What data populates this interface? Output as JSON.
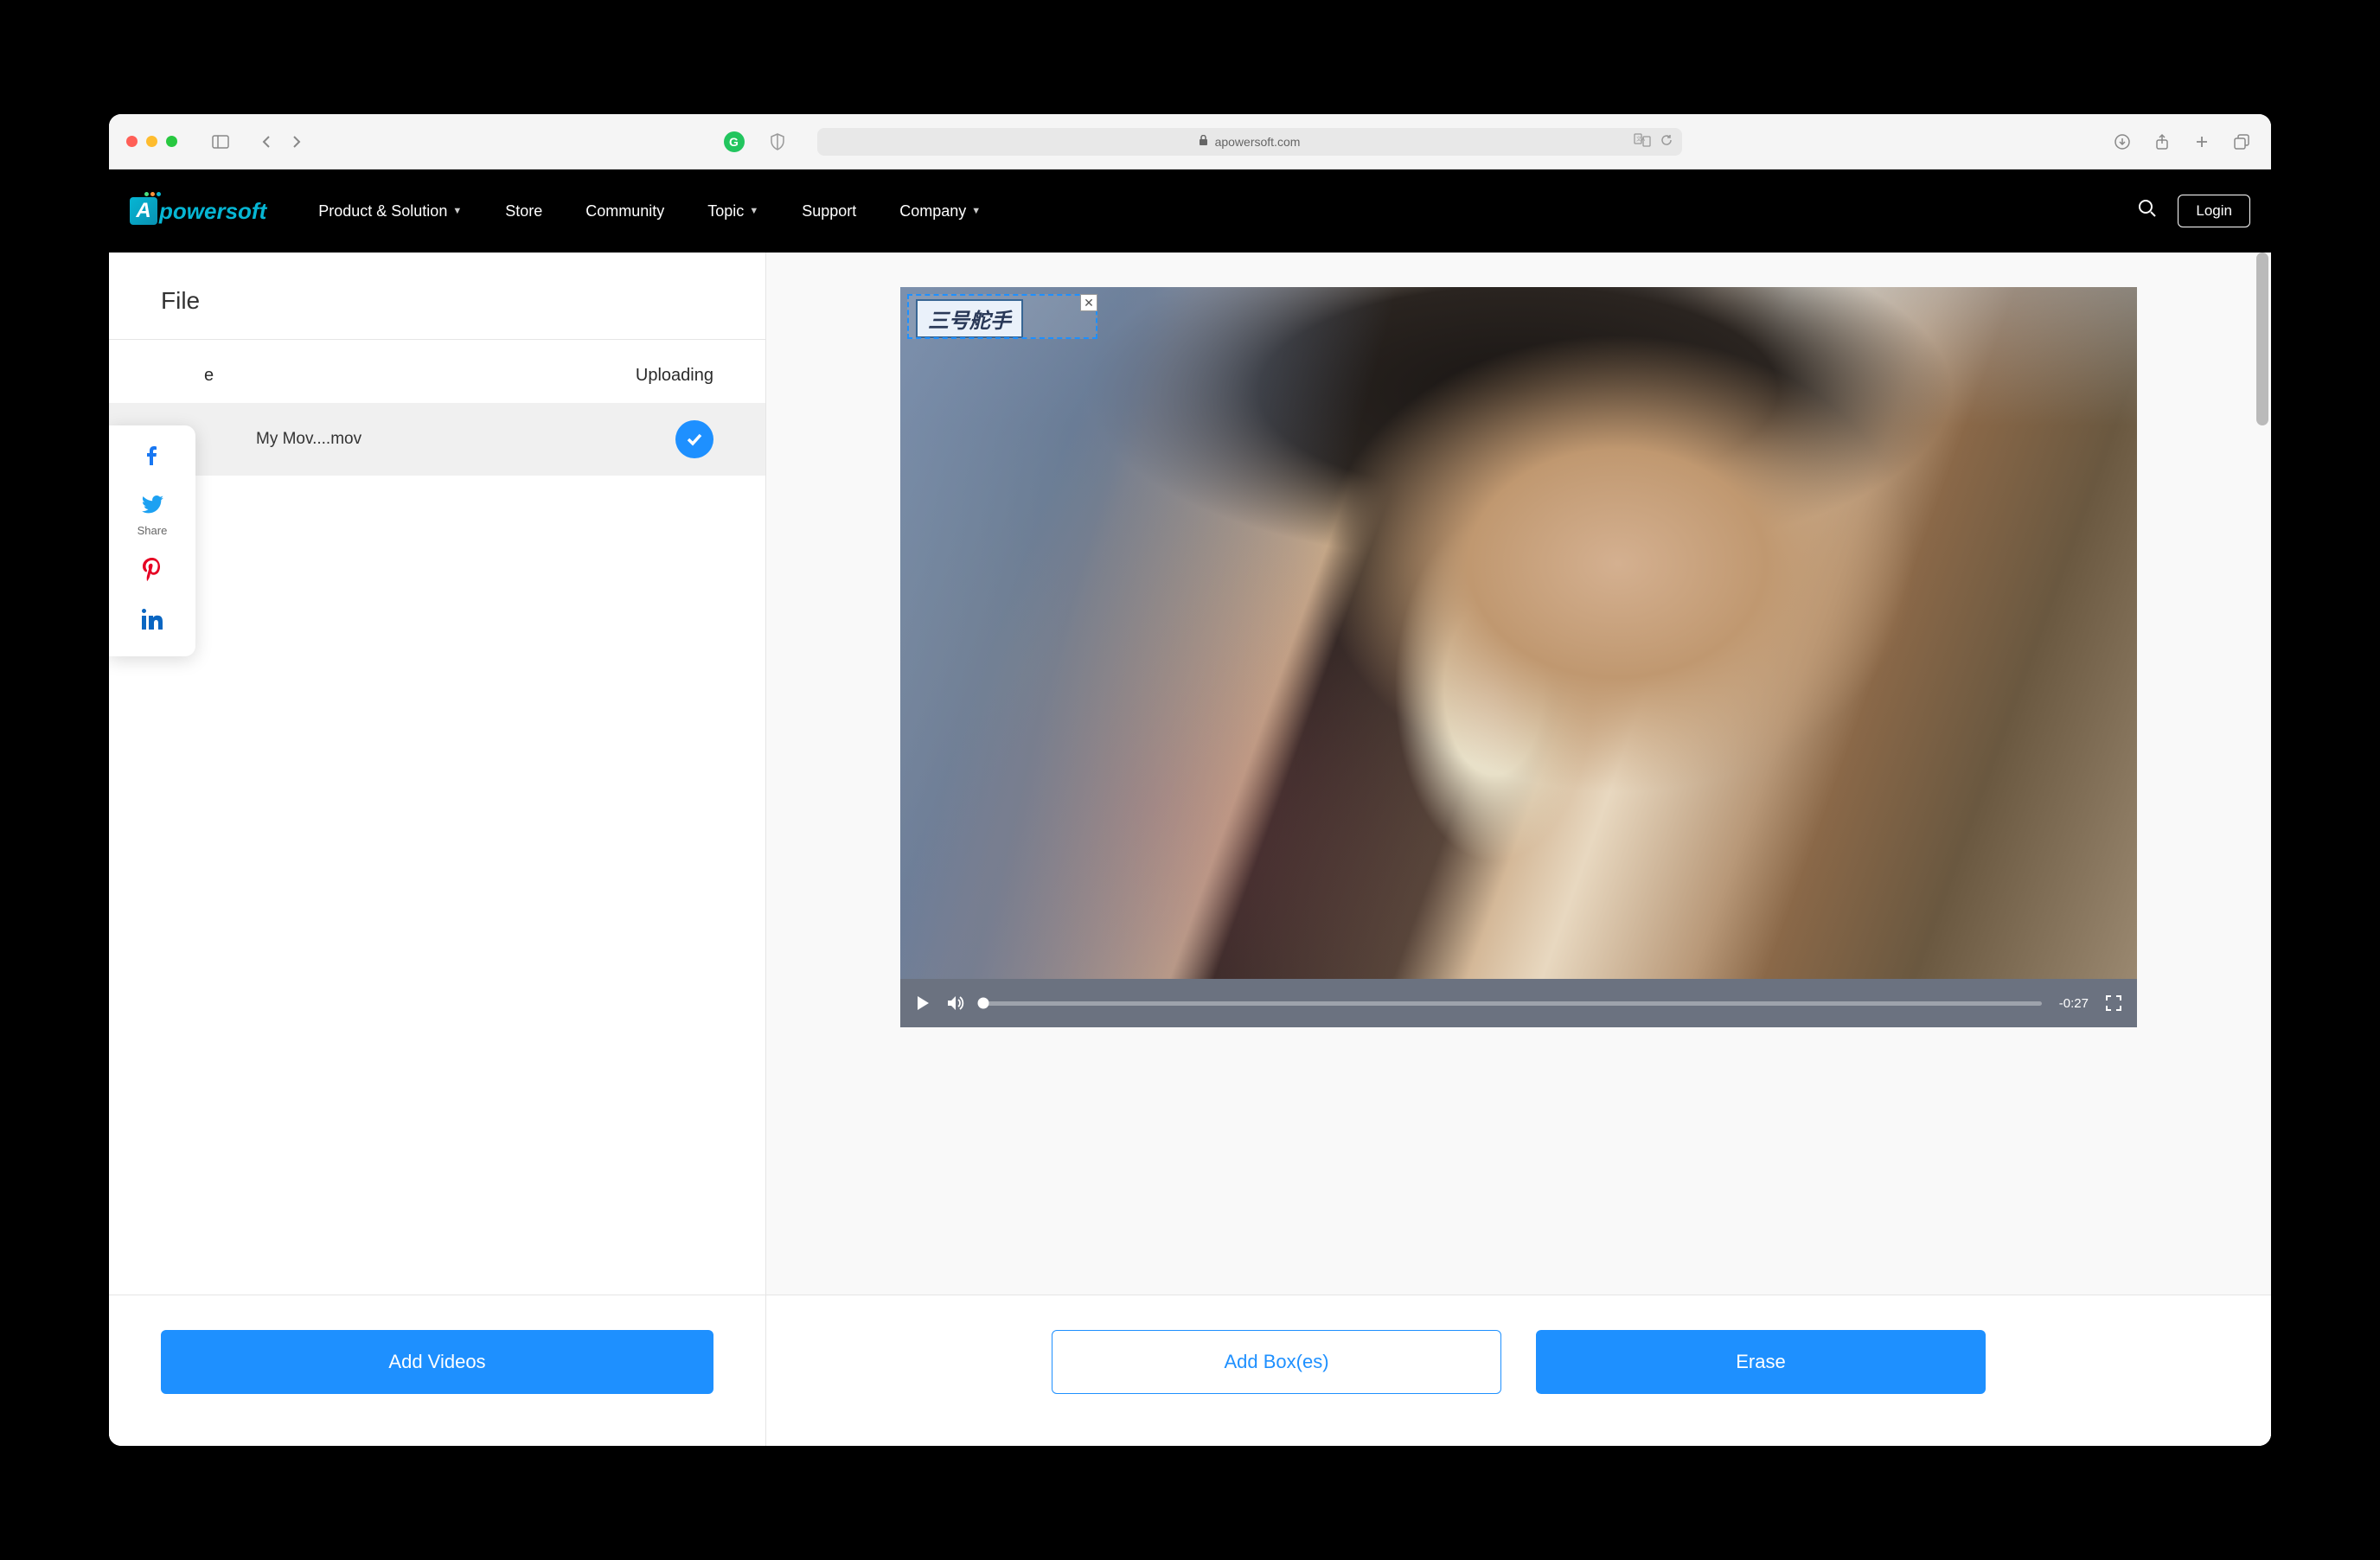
{
  "browser": {
    "url": "apowersoft.com"
  },
  "header": {
    "logo_text": "powersoft",
    "nav": [
      "Product & Solution",
      "Store",
      "Community",
      "Topic",
      "Support",
      "Company"
    ],
    "nav_dropdown": [
      true,
      false,
      false,
      true,
      false,
      true
    ],
    "login": "Login"
  },
  "sidebar": {
    "title": "File",
    "columns": {
      "name": "e",
      "status": "Uploading"
    },
    "file": {
      "name": "My Mov....mov"
    },
    "add_button": "Add Videos"
  },
  "preview": {
    "watermark": "三号舵手",
    "time": "-0:27",
    "add_box_button": "Add Box(es)",
    "erase_button": "Erase"
  },
  "share": {
    "label": "Share"
  }
}
